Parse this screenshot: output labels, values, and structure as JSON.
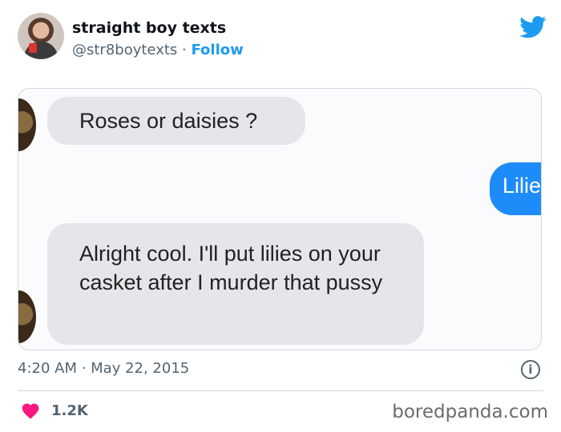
{
  "header": {
    "name": "straight boy texts",
    "handle": "@str8boytexts",
    "separator": " · ",
    "follow_label": "Follow",
    "avatar_icon": "profile-photo-avatar",
    "platform_icon": "twitter-bird-icon",
    "accent_color": "#1d9bf0"
  },
  "screenshot": {
    "messages": [
      {
        "side": "incoming",
        "text": "Roses or daisies ?"
      },
      {
        "side": "outgoing",
        "text": "Lilie"
      },
      {
        "side": "incoming",
        "text": "Alright cool. I'll put lilies on your casket after I murder that pussy"
      }
    ],
    "incoming_color": "#e5e5ea",
    "outgoing_color": "#1d8cf8"
  },
  "meta": {
    "timestamp": "4:20 AM · May 22, 2015",
    "info_icon": "info-icon"
  },
  "engagement": {
    "likes": "1.2K",
    "heart_icon": "heart-icon",
    "heart_color": "#f91880"
  },
  "watermark": "boredpanda.com"
}
